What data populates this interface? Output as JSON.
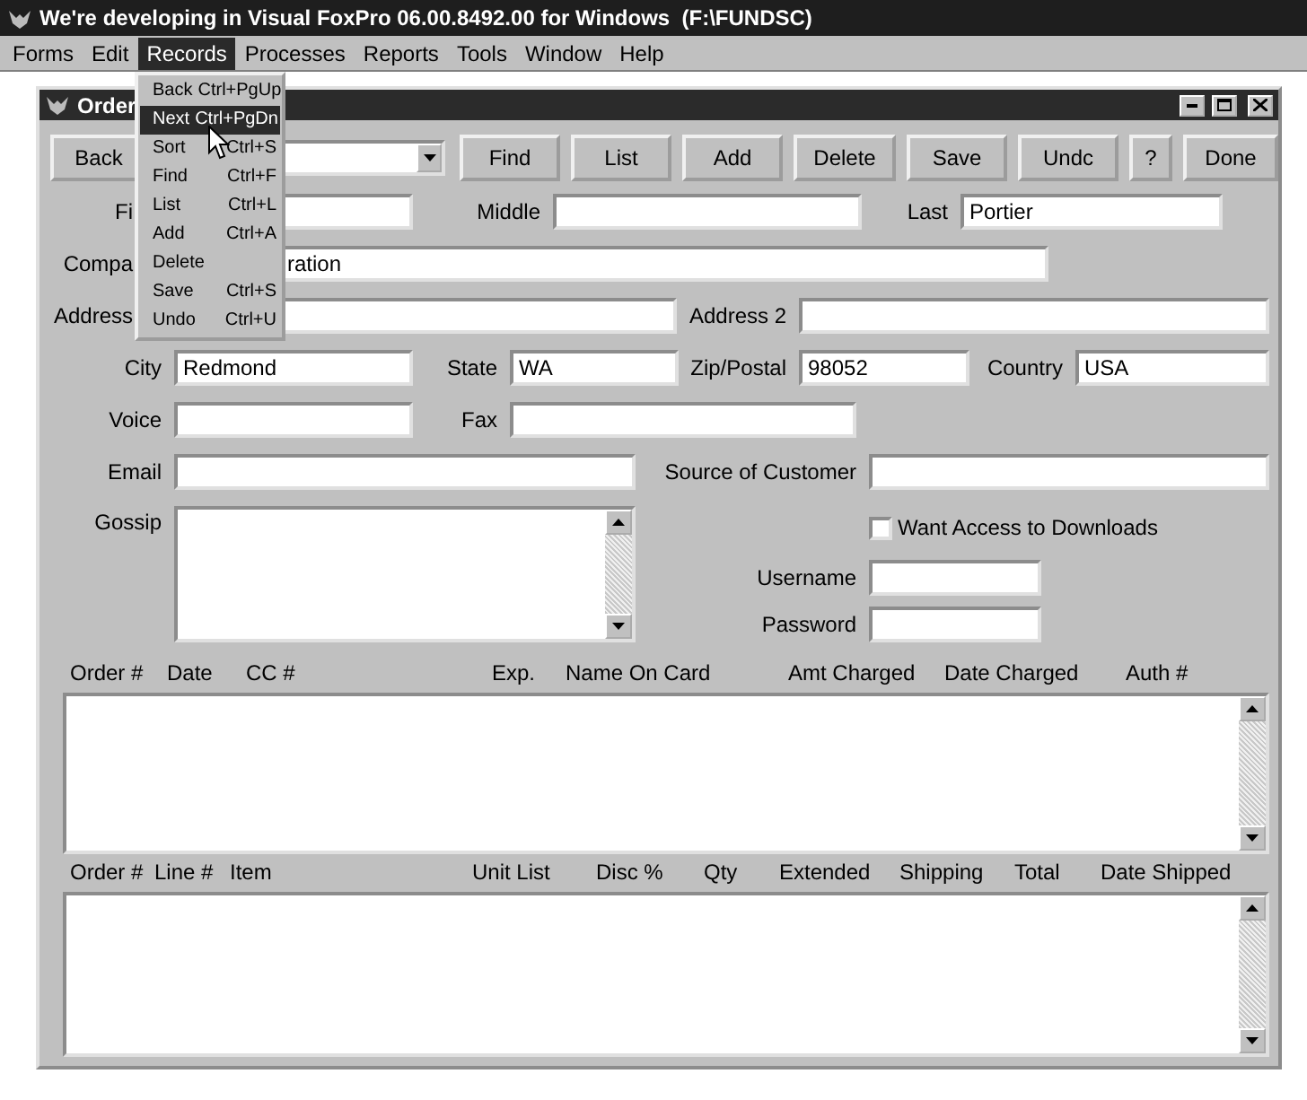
{
  "app": {
    "title": "We're developing in Visual FoxPro 06.00.8492.00 for Windows  (F:\\FUNDSC)"
  },
  "menu_bar": [
    {
      "label": "Forms",
      "selected": false
    },
    {
      "label": "Edit",
      "selected": false
    },
    {
      "label": "Records",
      "selected": true
    },
    {
      "label": "Processes",
      "selected": false
    },
    {
      "label": "Reports",
      "selected": false
    },
    {
      "label": "Tools",
      "selected": false
    },
    {
      "label": "Window",
      "selected": false
    },
    {
      "label": "Help",
      "selected": false
    }
  ],
  "records_menu": [
    {
      "label": "Back",
      "shortcut": "Ctrl+PgUp",
      "selected": false
    },
    {
      "label": "Next",
      "shortcut": "Ctrl+PgDn",
      "selected": true
    },
    {
      "label": "Sort",
      "shortcut": "Ctrl+S",
      "selected": false
    },
    {
      "label": "Find",
      "shortcut": "Ctrl+F",
      "selected": false
    },
    {
      "label": "List",
      "shortcut": "Ctrl+L",
      "selected": false
    },
    {
      "label": "Add",
      "shortcut": "Ctrl+A",
      "selected": false
    },
    {
      "label": "Delete",
      "selected": false
    },
    {
      "label": "Save",
      "shortcut": "Ctrl+S",
      "selected": false
    },
    {
      "label": "Undo",
      "shortcut": "Ctrl+U",
      "selected": false
    }
  ],
  "window": {
    "title": "Order"
  },
  "toolbar": [
    {
      "label": "Back"
    },
    {
      "label": "Find"
    },
    {
      "label": "List"
    },
    {
      "label": "Add"
    },
    {
      "label": "Delete"
    },
    {
      "label": "Save"
    },
    {
      "label": "Undc"
    },
    {
      "label": "?"
    },
    {
      "label": "Done"
    }
  ],
  "form": {
    "fields": [
      {
        "label": "Fi"
      },
      {
        "label": "Middle"
      },
      {
        "label": "Last",
        "value": "Portier"
      },
      {
        "label": "Compa",
        "value": "ration"
      },
      {
        "label": "Address"
      },
      {
        "label": "Address 2"
      },
      {
        "label": "City",
        "value": "Redmond"
      },
      {
        "label": "State",
        "value": "WA"
      },
      {
        "label": "Zip/Postal",
        "value": "98052"
      },
      {
        "label": "Country",
        "value": "USA"
      },
      {
        "label": "Voice"
      },
      {
        "label": "Fax"
      },
      {
        "label": "Email"
      },
      {
        "label": "Source of Customer"
      },
      {
        "label": "Gossip"
      }
    ],
    "checkbox": {
      "label": "Want Access to Downloads",
      "checked": false
    },
    "login": [
      {
        "label": "Username"
      },
      {
        "label": "Password"
      }
    ]
  },
  "order_grid": {
    "columns": [
      "Order #",
      "Date",
      "CC #",
      "Exp.",
      "Name On Card",
      "Amt Charged",
      "Date Charged",
      "Auth #"
    ]
  },
  "line_grid": {
    "columns": [
      "Order #",
      "Line #",
      "Item",
      "Unit List",
      "Disc %",
      "Qty",
      "Extended",
      "Shipping",
      "Total",
      "Date Shipped"
    ]
  }
}
